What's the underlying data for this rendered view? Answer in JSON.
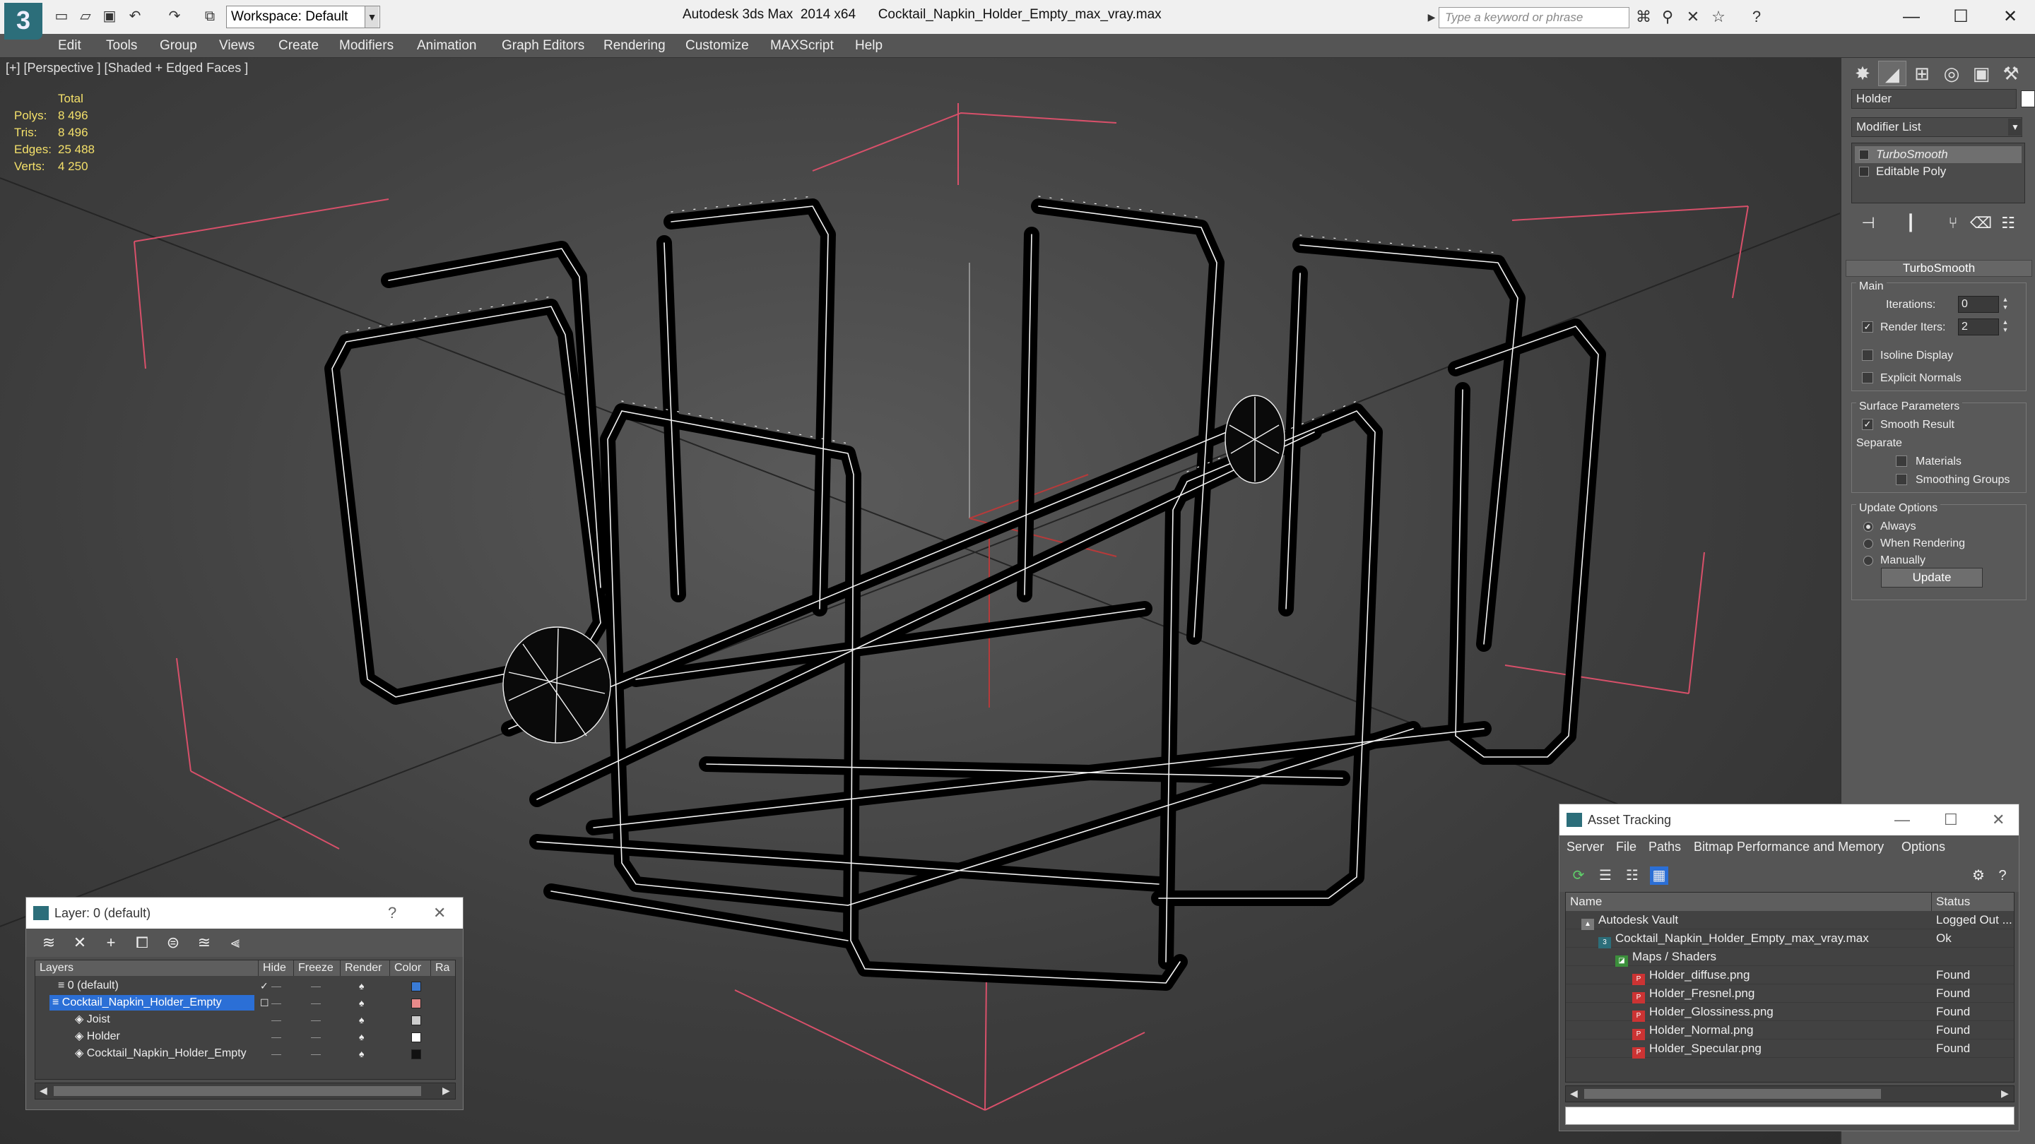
{
  "app": {
    "logo_text": "3",
    "workspace": "Workspace: Default",
    "title": "Autodesk 3ds Max  2014 x64      Cocktail_Napkin_Holder_Empty_max_vray.max",
    "search_placeholder": "Type a keyword or phrase"
  },
  "menu": [
    "Edit",
    "Tools",
    "Group",
    "Views",
    "Create",
    "Modifiers",
    "Animation",
    "Graph Editors",
    "Rendering",
    "Customize",
    "MAXScript",
    "Help"
  ],
  "viewport": {
    "label": "[+] [Perspective ] [Shaded + Edged Faces ]",
    "stats": {
      "header": "Total",
      "rows": [
        {
          "k": "Polys:",
          "v": "8 496"
        },
        {
          "k": "Tris:",
          "v": "8 496"
        },
        {
          "k": "Edges:",
          "v": "25 488"
        },
        {
          "k": "Verts:",
          "v": "4 250"
        }
      ]
    }
  },
  "command_panel": {
    "object_name": "Holder",
    "modifier_list": "Modifier List",
    "stack": [
      "TurboSmooth",
      "Editable Poly"
    ],
    "rollout_title": "TurboSmooth",
    "main_group": "Main",
    "iterations_label": "Iterations:",
    "iterations_value": "0",
    "render_iters_label": "Render Iters:",
    "render_iters_value": "2",
    "render_iters_checked": true,
    "isoline": "Isoline Display",
    "explicit_normals": "Explicit Normals",
    "surface_group": "Surface Parameters",
    "smooth_result": "Smooth Result",
    "separate": "Separate",
    "materials": "Materials",
    "smoothing_groups": "Smoothing Groups",
    "update_group": "Update Options",
    "always": "Always",
    "when_rendering": "When Rendering",
    "manually": "Manually",
    "update_button": "Update"
  },
  "layer_window": {
    "title": "Layer: 0 (default)",
    "columns": [
      "Layers",
      "Hide",
      "Freeze",
      "Render",
      "Color",
      "Ra"
    ],
    "rows": [
      {
        "name": "0 (default)",
        "color": "#3a7bd5",
        "indent": 1,
        "selected": false,
        "current": true
      },
      {
        "name": "Cocktail_Napkin_Holder_Empty",
        "color": "#e88a8a",
        "indent": 1,
        "selected": true,
        "current": false
      },
      {
        "name": "Joist",
        "color": "#cccccc",
        "indent": 2,
        "selected": false,
        "current": false
      },
      {
        "name": "Holder",
        "color": "#ffffff",
        "indent": 2,
        "selected": false,
        "current": false
      },
      {
        "name": "Cocktail_Napkin_Holder_Empty",
        "color": "#111111",
        "indent": 2,
        "selected": false,
        "current": false
      }
    ]
  },
  "asset_window": {
    "title": "Asset Tracking",
    "menu": [
      "Server",
      "File",
      "Paths",
      "Bitmap Performance and Memory",
      "Options"
    ],
    "columns": [
      "Name",
      "Status"
    ],
    "rows": [
      {
        "name": "Autodesk Vault",
        "status": "Logged Out ...",
        "indent": 1,
        "icon": "vault"
      },
      {
        "name": "Cocktail_Napkin_Holder_Empty_max_vray.max",
        "status": "Ok",
        "indent": 2,
        "icon": "max"
      },
      {
        "name": "Maps / Shaders",
        "status": "",
        "indent": 3,
        "icon": "maps"
      },
      {
        "name": "Holder_diffuse.png",
        "status": "Found",
        "indent": 4,
        "icon": "png"
      },
      {
        "name": "Holder_Fresnel.png",
        "status": "Found",
        "indent": 4,
        "icon": "png"
      },
      {
        "name": "Holder_Glossiness.png",
        "status": "Found",
        "indent": 4,
        "icon": "png"
      },
      {
        "name": "Holder_Normal.png",
        "status": "Found",
        "indent": 4,
        "icon": "png"
      },
      {
        "name": "Holder_Specular.png",
        "status": "Found",
        "indent": 4,
        "icon": "png"
      }
    ]
  }
}
